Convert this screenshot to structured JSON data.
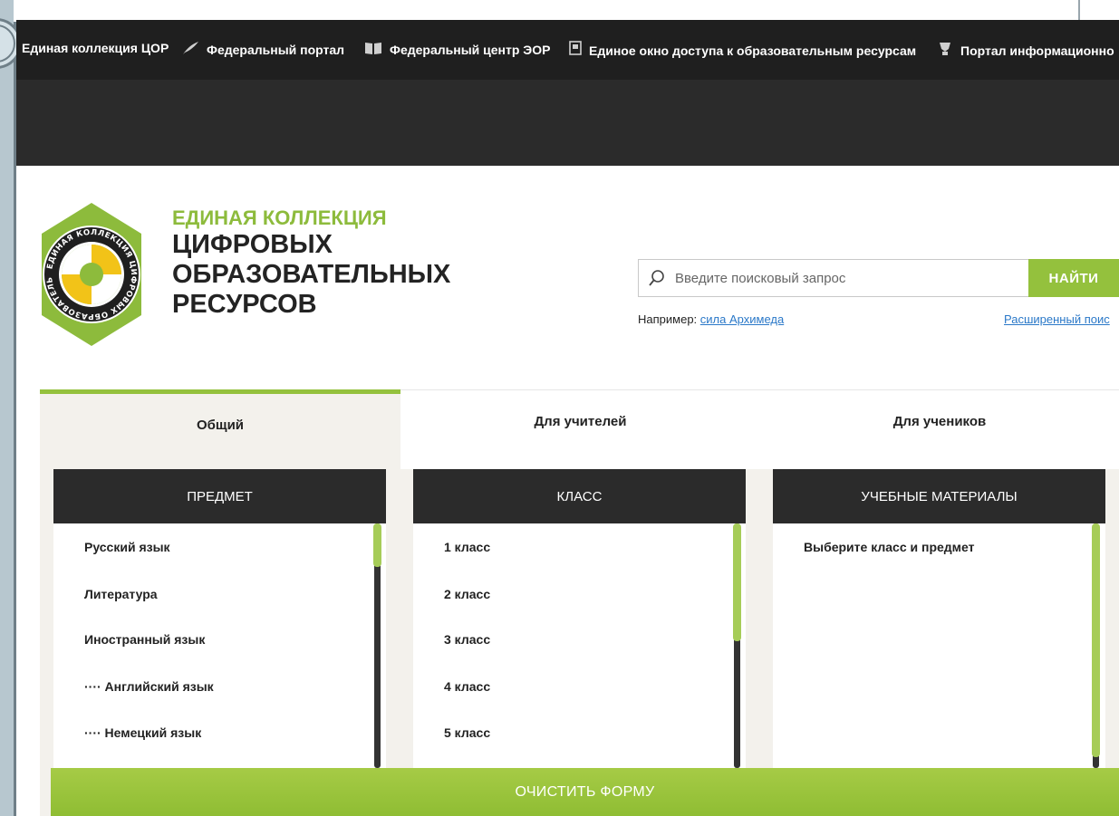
{
  "topbar": {
    "links": [
      {
        "label": "Единая коллекция ЦОР",
        "icon": ""
      },
      {
        "label": "Федеральный портал",
        "icon": "feather-icon"
      },
      {
        "label": "Федеральный центр ЭОР",
        "icon": "book-icon"
      },
      {
        "label": "Единое окно доступа к образовательным ресурсам",
        "icon": "window-icon"
      },
      {
        "label": "Портал информационно",
        "icon": "award-icon"
      }
    ]
  },
  "brand": {
    "line1": "ЕДИНАЯ КОЛЛЕКЦИЯ",
    "line2": "ЦИФРОВЫХ",
    "line3": "ОБРАЗОВАТЕЛЬНЫХ",
    "line4": "РЕСУРСОВ",
    "logo_ring_text": "ЕДИНАЯ КОЛЛЕКЦИЯ ЦИФРОВЫХ ОБРАЗОВАТЕЛЬНЫХ РЕСУРСОВ"
  },
  "search": {
    "placeholder": "Введите поисковый запрос",
    "button_label": "НАЙТИ",
    "example_prefix": "Например:",
    "example_link": "сила Архимеда",
    "advanced_link": "Расширенный поис"
  },
  "tabs": [
    {
      "label": "Общий",
      "active": true
    },
    {
      "label": "Для учителей",
      "active": false
    },
    {
      "label": "Для учеников",
      "active": false
    }
  ],
  "columns": {
    "subject": {
      "header": "ПРЕДМЕТ",
      "items": [
        "Русский язык",
        "Литература",
        "Иностранный язык",
        "···· Английский язык",
        "···· Немецкий язык"
      ]
    },
    "grade": {
      "header": "КЛАСС",
      "items": [
        "1 класс",
        "2 класс",
        "3 класс",
        "4 класс",
        "5 класс"
      ]
    },
    "materials": {
      "header": "УЧЕБНЫЕ МАТЕРИАЛЫ",
      "items": [
        "Выберите класс и предмет"
      ]
    }
  },
  "clear_button_label": "ОЧИСТИТЬ ФОРМУ",
  "colors": {
    "accent": "#94c13d",
    "dark": "#2b2b2b",
    "link": "#2a78c8",
    "logo_yellow": "#f2c318"
  }
}
